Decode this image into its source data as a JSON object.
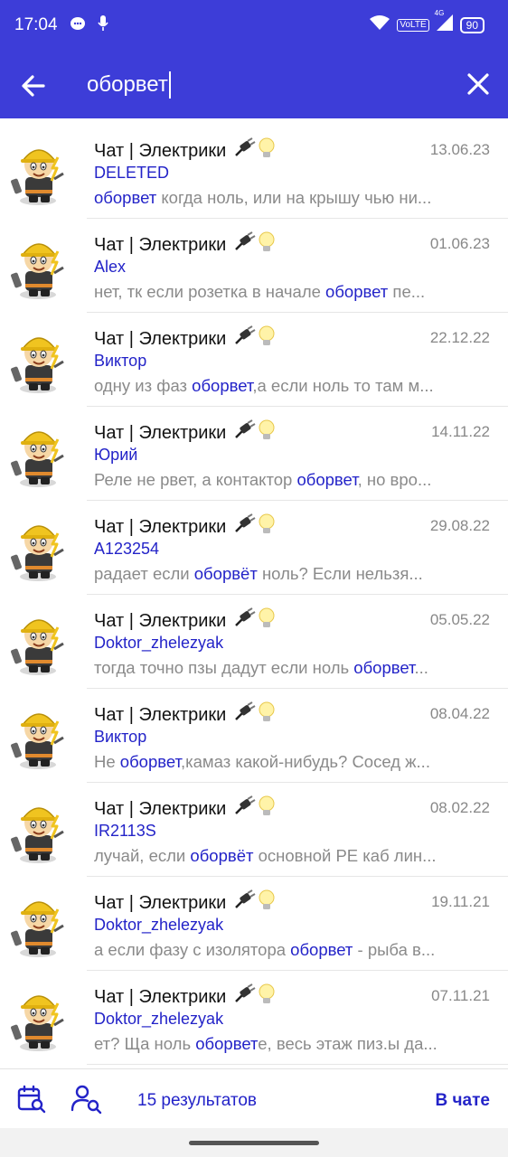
{
  "status_bar": {
    "time": "17:04",
    "battery": "90",
    "network": "VoLTE",
    "net_gen": "4G"
  },
  "search": {
    "query": "оборвет"
  },
  "colors": {
    "primary": "#3d3dd8",
    "link": "#2323c8",
    "muted": "#8a8a8a"
  },
  "results": [
    {
      "chat": "Чат | Электрики",
      "date": "13.06.23",
      "author": "DELETED",
      "before": "",
      "match": "оборвет",
      "after": " когда ноль, или на крышу чью ни..."
    },
    {
      "chat": "Чат | Электрики",
      "date": "01.06.23",
      "author": "Alex",
      "before": "нет, тк если розетка в начале ",
      "match": "оборвет",
      "after": " пе..."
    },
    {
      "chat": "Чат | Электрики",
      "date": "22.12.22",
      "author": "Виктор",
      "before": "одну из фаз ",
      "match": "оборвет",
      "after": ",а если ноль то там м..."
    },
    {
      "chat": "Чат | Электрики",
      "date": "14.11.22",
      "author": "Юрий",
      "before": "Реле не рвет, а контактор ",
      "match": "оборвет",
      "after": ", но вро..."
    },
    {
      "chat": "Чат | Электрики",
      "date": "29.08.22",
      "author": "A123254",
      "before": "радает если ",
      "match": "оборвёт",
      "after": " ноль?  Если нельзя..."
    },
    {
      "chat": "Чат | Электрики",
      "date": "05.05.22",
      "author": "Doktor_zhelezyak",
      "before": "тогда точно пзы дадут если ноль ",
      "match": "оборвет",
      "after": "..."
    },
    {
      "chat": "Чат | Электрики",
      "date": "08.04.22",
      "author": "Виктор",
      "before": "Не ",
      "match": "оборвет",
      "after": ",камаз какой-нибудь? Сосед ж..."
    },
    {
      "chat": "Чат | Электрики",
      "date": "08.02.22",
      "author": "IR2113S",
      "before": "лучай, если ",
      "match": "оборвёт",
      "after": " основной PE каб лин..."
    },
    {
      "chat": "Чат | Электрики",
      "date": "19.11.21",
      "author": "Doktor_zhelezyak",
      "before": "а если фазу с изолятора ",
      "match": "оборвет",
      "after": " - рыба в..."
    },
    {
      "chat": "Чат | Электрики",
      "date": "07.11.21",
      "author": "Doktor_zhelezyak",
      "before": "ет? Ща ноль ",
      "match": "оборвет",
      "after": "е, весь этаж пиз.ы да..."
    }
  ],
  "bottom_bar": {
    "results_count": "15 результатов",
    "in_chat": "В чате"
  }
}
